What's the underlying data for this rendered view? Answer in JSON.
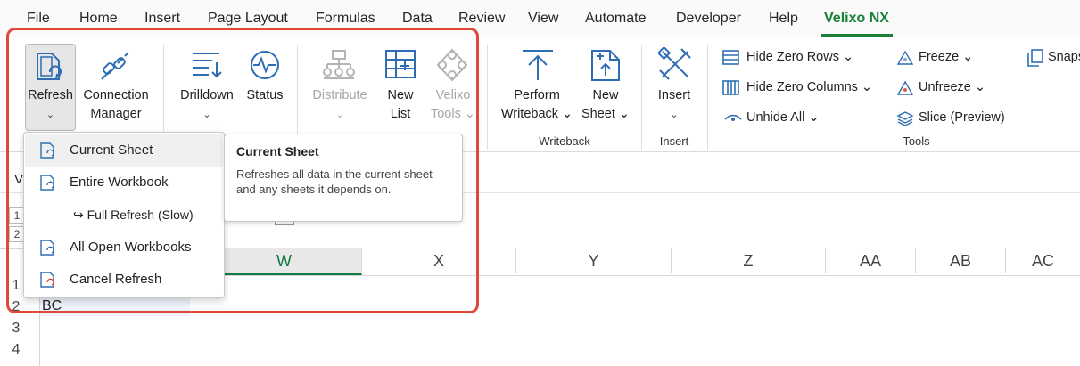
{
  "menu": {
    "tabs": [
      "File",
      "Home",
      "Insert",
      "Page Layout",
      "Formulas",
      "Data",
      "Review",
      "View",
      "Automate",
      "Developer",
      "Help",
      "Velixo NX"
    ],
    "active_tab": "Velixo NX"
  },
  "ribbon": {
    "refresh": {
      "label": "Refresh",
      "chevron": "⌄"
    },
    "connection_manager": {
      "line1": "Connection",
      "line2": "Manager"
    },
    "drilldown": {
      "label": "Drilldown",
      "chevron": "⌄"
    },
    "status": {
      "label": "Status"
    },
    "distribute": {
      "label": "Distribute",
      "chevron": "⌄"
    },
    "new_list": {
      "line1": "New",
      "line2": "List"
    },
    "velixo_tools": {
      "line1": "Velixo",
      "line2": "Tools ⌄"
    },
    "perform_writeback": {
      "line1": "Perform",
      "line2": "Writeback ⌄"
    },
    "new_sheet": {
      "line1": "New",
      "line2": "Sheet ⌄"
    },
    "insert": {
      "label": "Insert",
      "chevron": "⌄"
    },
    "groups": {
      "writeback": "Writeback",
      "insert": "Insert",
      "tools": "Tools"
    },
    "tools": {
      "hide_zero_rows": "Hide Zero Rows ⌄",
      "hide_zero_columns": "Hide Zero Columns ⌄",
      "unhide_all": "Unhide All ⌄",
      "freeze": "Freeze ⌄",
      "unfreeze": "Unfreeze ⌄",
      "slice_preview": "Slice (Preview)",
      "snapshot": "Snaps"
    }
  },
  "dropdown": {
    "items": [
      {
        "label": "Current Sheet",
        "icon": "refresh-sheet-icon"
      },
      {
        "label": "Entire Workbook",
        "icon": "refresh-workbook-icon"
      },
      {
        "label": "↪ Full Refresh (Slow)"
      },
      {
        "label": "All Open Workbooks",
        "icon": "refresh-all-icon"
      },
      {
        "label": "Cancel Refresh",
        "icon": "cancel-refresh-icon"
      }
    ]
  },
  "tooltip": {
    "title": "Current Sheet",
    "body": "Refreshes all data in the current sheet and any sheets it depends on."
  },
  "sheet": {
    "formula_bar_cell": "V",
    "outline_levels": [
      "1",
      "2"
    ],
    "columns": [
      "W",
      "X",
      "Y",
      "Z",
      "AA",
      "AB",
      "AC"
    ],
    "rows": [
      "1",
      "2",
      "3",
      "4"
    ],
    "cell_a2": "BC"
  },
  "colors": {
    "accent": "#1a7f37",
    "highlight": "#e0483a",
    "icon_blue": "#2e6db4"
  }
}
